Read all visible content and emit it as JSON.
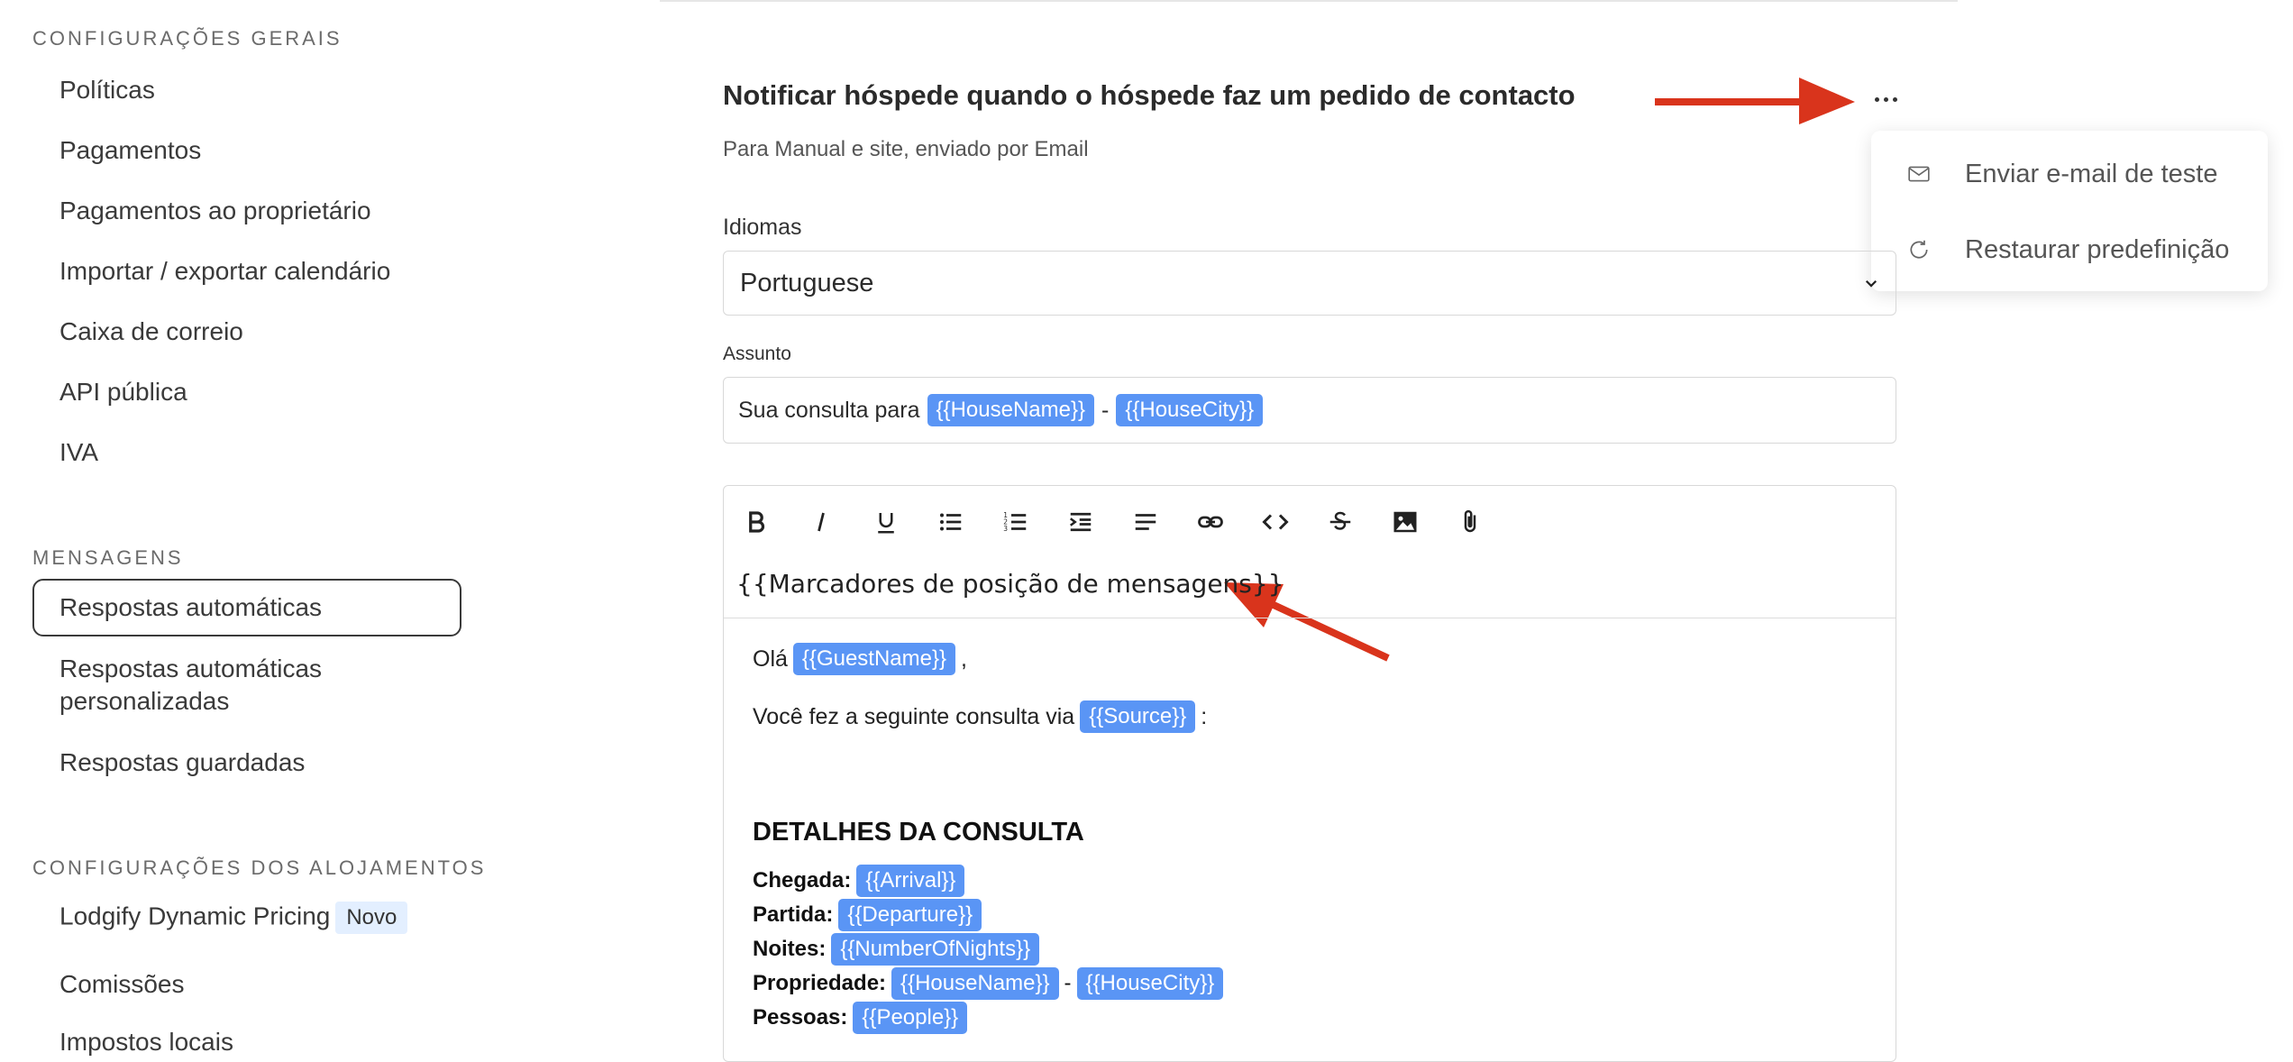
{
  "sidebar": {
    "sections": [
      {
        "heading": "CONFIGURAÇÕES GERAIS",
        "items": [
          "Políticas",
          "Pagamentos",
          "Pagamentos ao proprietário",
          "Importar / exportar calendário",
          "Caixa de correio",
          "API pública",
          "IVA"
        ]
      },
      {
        "heading": "MENSAGENS",
        "items": [
          "Respostas automáticas",
          "Respostas automáticas personalizadas",
          "Respostas guardadas"
        ]
      },
      {
        "heading": "CONFIGURAÇÕES DOS ALOJAMENTOS",
        "items": [
          "Lodgify Dynamic Pricing",
          "Comissões",
          "Impostos locais"
        ],
        "badge": "Novo"
      }
    ]
  },
  "main": {
    "title": "Notificar hóspede quando o hóspede faz um pedido de contacto",
    "subtitle": "Para Manual e site, enviado por Email",
    "menu": {
      "send_test": "Enviar e-mail de teste",
      "restore": "Restaurar predefinição"
    },
    "languages_label": "Idiomas",
    "language_value": "Portuguese",
    "subject_label": "Assunto",
    "subject": {
      "prefix": "Sua consulta para",
      "chip1": "{{HouseName}}",
      "separator": "-",
      "chip2": "{{HouseCity}}"
    },
    "editor": {
      "placeholders_menu": "{{Marcadores de posição de mensagens}}",
      "greeting": "Olá",
      "greeting_chip": "{{GuestName}}",
      "greeting_suffix": ",",
      "line2": "Você fez a seguinte consulta via",
      "line2_chip": "{{Source}}",
      "line2_suffix": ":",
      "heading": "DETALHES DA CONSULTA",
      "details": [
        {
          "label": "Chegada:",
          "chip": "{{Arrival}}"
        },
        {
          "label": "Partida:",
          "chip": "{{Departure}}"
        },
        {
          "label": "Noites:",
          "chip": "{{NumberOfNights}}"
        },
        {
          "label": "Propriedade:",
          "chip": "{{HouseName}}",
          "separator": "-",
          "chip2": "{{HouseCity}}"
        },
        {
          "label": "Pessoas:",
          "chip": "{{People}}"
        }
      ]
    }
  },
  "colors": {
    "chip": "#5a95f5",
    "arrow": "#d9341c"
  },
  "icons": [
    "bold-icon",
    "italic-icon",
    "underline-icon",
    "bullet-list-icon",
    "numbered-list-icon",
    "indent-icon",
    "align-icon",
    "link-icon",
    "code-icon",
    "strikethrough-icon",
    "image-icon",
    "attachment-icon",
    "mail-icon",
    "refresh-icon",
    "chevron-down-icon",
    "more-icon"
  ]
}
